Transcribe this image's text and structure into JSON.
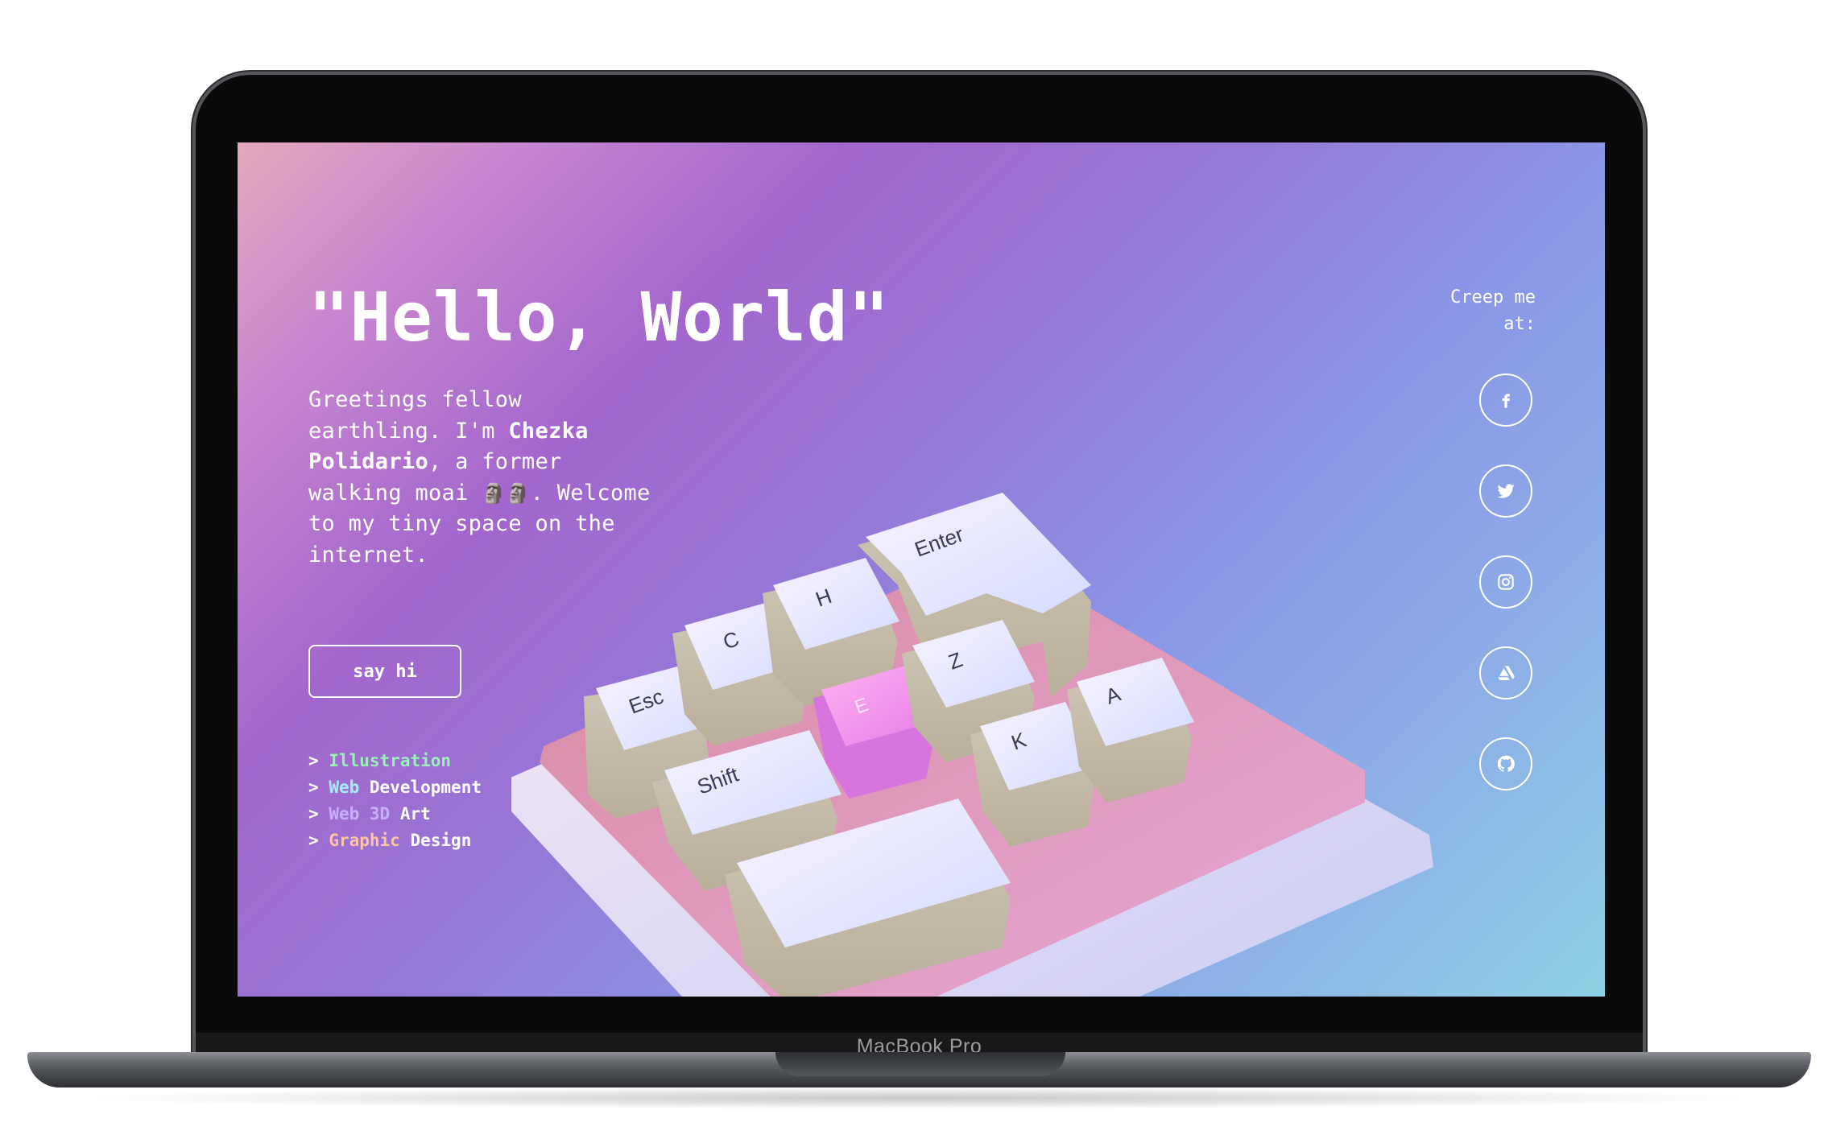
{
  "device": {
    "brand_label": "MacBook Pro"
  },
  "hero": {
    "title": "\"Hello, World\"",
    "intro_1": "Greetings fellow earthling. I'm ",
    "name": "Chezka Polidario",
    "intro_2": ", a former walking moai ",
    "emoji": "🗿🗿",
    "intro_3": ". Welcome to my tiny space on the internet."
  },
  "cta": {
    "say_hi_label": "say hi"
  },
  "skills": [
    {
      "prefix": ">",
      "a": "Illustration",
      "b": ""
    },
    {
      "prefix": ">",
      "a": "Web",
      "b": "Development"
    },
    {
      "prefix": ">",
      "a": "Web 3D",
      "b": "Art"
    },
    {
      "prefix": ">",
      "a": "Graphic",
      "b": "Design"
    }
  ],
  "social": {
    "heading": "Creep me at:",
    "links": [
      {
        "name": "facebook",
        "icon": "facebook-icon"
      },
      {
        "name": "twitter",
        "icon": "twitter-icon"
      },
      {
        "name": "instagram",
        "icon": "instagram-icon"
      },
      {
        "name": "artstation",
        "icon": "artstation-icon"
      },
      {
        "name": "github",
        "icon": "github-icon"
      }
    ]
  },
  "keycaps": {
    "esc": "Esc",
    "c": "C",
    "h": "H",
    "enter": "Enter",
    "shift": "Shift",
    "e": "E",
    "z": "Z",
    "k": "K",
    "a": "A"
  },
  "colors": {
    "accent_green": "#9af2b8",
    "accent_cyan": "#a6ecff",
    "accent_lavender": "#c7b1ff",
    "accent_peach": "#ffc4a8"
  }
}
